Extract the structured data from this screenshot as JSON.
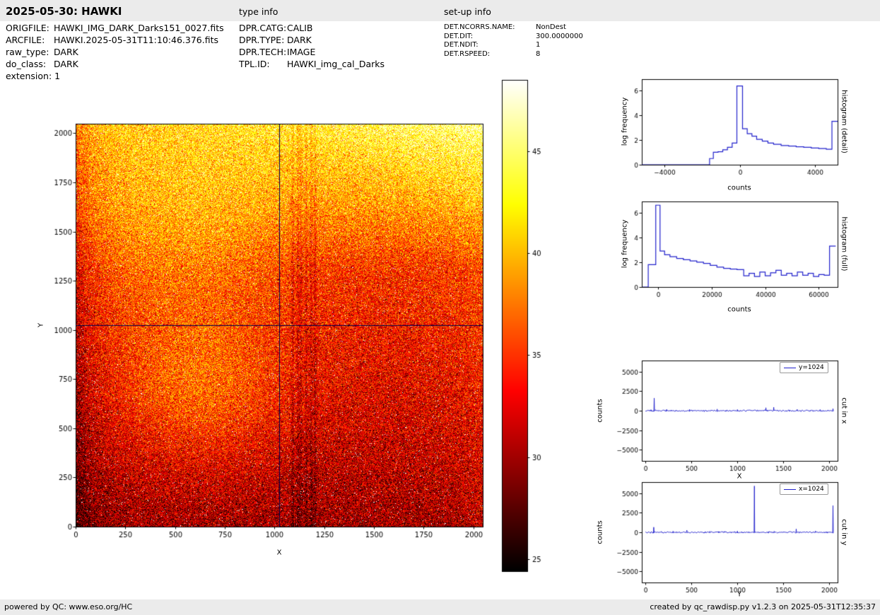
{
  "header": {
    "title": "2025-05-30: HAWKI",
    "type_info": "type info",
    "setup_info": "set-up info"
  },
  "metadata": {
    "left": [
      {
        "label": "ORIGFILE:",
        "value": "HAWKI_IMG_DARK_Darks151_0027.fits"
      },
      {
        "label": "ARCFILE:",
        "value": "HAWKI.2025-05-31T11:10:46.376.fits"
      },
      {
        "label": "raw_type:",
        "value": "DARK"
      },
      {
        "label": "do_class:",
        "value": "DARK"
      },
      {
        "label": "extension:",
        "value": "1"
      }
    ],
    "middle": [
      {
        "label": "DPR.CATG:",
        "value": "CALIB"
      },
      {
        "label": "DPR.TYPE:",
        "value": "DARK"
      },
      {
        "label": "DPR.TECH:",
        "value": "IMAGE"
      },
      {
        "label": "TPL.ID:",
        "value": "HAWKI_img_cal_Darks"
      }
    ],
    "right": [
      {
        "label": "DET.NCORRS.NAME:",
        "value": "NonDest"
      },
      {
        "label": "DET.DIT:",
        "value": "300.0000000"
      },
      {
        "label": "DET.NDIT:",
        "value": "1"
      },
      {
        "label": "DET.RSPEED:",
        "value": "8"
      }
    ]
  },
  "footer": {
    "left": "powered by QC: www.eso.org/HC",
    "right": "created by qc_rawdisp.py v1.2.3 on 2025-05-31T12:35:37"
  },
  "colors": {
    "line_blue": "#2222cc",
    "crosshair_navy": "#00004d",
    "bar_gray": "#ebebeb"
  },
  "chart_data": [
    {
      "id": "detector-image",
      "type": "heatmap",
      "xlabel": "X",
      "ylabel": "Y",
      "x_range": [
        0,
        2048
      ],
      "y_range": [
        0,
        2048
      ],
      "x_ticks": [
        0,
        250,
        500,
        750,
        1000,
        1250,
        1500,
        1750,
        2000
      ],
      "y_ticks": [
        0,
        250,
        500,
        750,
        1000,
        1250,
        1500,
        1750,
        2000
      ],
      "value_range": [
        24.4,
        48.5
      ],
      "colormap": "hot",
      "crosshair": {
        "x": 1024,
        "y": 1024,
        "color": "#00004d"
      },
      "appearance": {
        "base_level": 30.0,
        "vertical_gradient": 7.5,
        "top_boost": {
          "start_y": 1300,
          "left_amp": 3.0,
          "right_amp": 7.5
        },
        "blobs": [
          {
            "x": 620,
            "y": 680,
            "sx": 300,
            "sy": 260,
            "amp": 4.2
          },
          {
            "x": 520,
            "y": 1500,
            "sx": 380,
            "sy": 380,
            "amp": 3.0
          }
        ],
        "left_edge_dark": 3.5,
        "right_edge_boost": 1.3,
        "noise_sigma": 2.9,
        "dark_stripes_x": [
          1092,
          1118,
          1133,
          1160,
          1185,
          1205
        ]
      }
    },
    {
      "id": "colorbar",
      "type": "colorbar",
      "ticks": [
        25,
        30,
        35,
        40,
        45
      ],
      "range": [
        24.4,
        48.5
      ],
      "colormap": "hot"
    },
    {
      "id": "histogram-detail",
      "type": "bar",
      "title": "histogram (detail)",
      "xlabel": "counts",
      "ylabel": "log frequency",
      "xlim": [
        -5200,
        5200
      ],
      "ylim": [
        0,
        6.9
      ],
      "x_ticks": [
        -4000,
        0,
        4000
      ],
      "y_ticks": [
        0,
        2,
        4,
        6
      ],
      "line_color": "#2222cc",
      "bin_edges": [
        -5200,
        -1600,
        -1400,
        -1150,
        -900,
        -650,
        -400,
        -150,
        150,
        400,
        650,
        900,
        1200,
        1500,
        1800,
        2200,
        2600,
        3000,
        3400,
        3800,
        4200,
        4600,
        4900,
        5200
      ],
      "log_heights": [
        0,
        0.5,
        1.0,
        1.05,
        1.2,
        1.4,
        1.75,
        6.35,
        2.9,
        2.5,
        2.3,
        2.05,
        1.9,
        1.75,
        1.65,
        1.55,
        1.5,
        1.45,
        1.4,
        1.35,
        1.3,
        1.25,
        3.5
      ]
    },
    {
      "id": "histogram-full",
      "type": "bar",
      "title": "histogram (full)",
      "xlabel": "counts",
      "ylabel": "log frequency",
      "xlim": [
        -6000,
        67000
      ],
      "ylim": [
        0,
        6.9
      ],
      "x_ticks": [
        0,
        20000,
        40000,
        60000
      ],
      "y_ticks": [
        0,
        2,
        4,
        6
      ],
      "line_color": "#2222cc",
      "bin_edges": [
        -5700,
        -3600,
        -800,
        800,
        2500,
        4500,
        7000,
        9500,
        12000,
        14500,
        17000,
        19500,
        22000,
        24500,
        27000,
        29500,
        32000,
        34000,
        36000,
        38000,
        40000,
        42000,
        44000,
        46000,
        48000,
        50000,
        52000,
        54000,
        56000,
        58000,
        60000,
        62000,
        64000,
        66300
      ],
      "log_heights": [
        0,
        1.8,
        6.6,
        2.9,
        2.6,
        2.45,
        2.3,
        2.2,
        2.1,
        2.0,
        1.9,
        1.75,
        1.6,
        1.5,
        1.45,
        1.4,
        0.9,
        1.1,
        0.85,
        1.2,
        0.9,
        1.15,
        1.35,
        0.95,
        1.1,
        0.9,
        1.2,
        0.95,
        1.1,
        0.85,
        1.0,
        0.95,
        3.3
      ]
    },
    {
      "id": "cut-in-x",
      "type": "line",
      "title": "cut in x",
      "xlabel": "X",
      "ylabel": "counts",
      "legend": "y=1024",
      "xlim": [
        -40,
        2090
      ],
      "ylim": [
        -6400,
        6400
      ],
      "x_ticks": [
        0,
        500,
        1000,
        1500,
        2000
      ],
      "y_ticks": [
        -5000,
        -2500,
        0,
        2500,
        5000
      ],
      "line_color": "#2222cc",
      "baseline": 0,
      "noise_amp": 120,
      "spikes": [
        [
          60,
          120
        ],
        [
          95,
          1600
        ],
        [
          230,
          160
        ],
        [
          480,
          170
        ],
        [
          640,
          -120
        ],
        [
          780,
          200
        ],
        [
          1000,
          140
        ],
        [
          1310,
          380
        ],
        [
          1395,
          450
        ],
        [
          1650,
          150
        ],
        [
          1900,
          130
        ],
        [
          2040,
          260
        ]
      ]
    },
    {
      "id": "cut-in-y",
      "type": "line",
      "title": "cut in y",
      "xlabel": "Y",
      "ylabel": "counts",
      "legend": "x=1024",
      "xlim": [
        -40,
        2090
      ],
      "ylim": [
        -6400,
        6400
      ],
      "x_ticks": [
        0,
        500,
        1000,
        1500,
        2000
      ],
      "y_ticks": [
        -5000,
        -2500,
        0,
        2500,
        5000
      ],
      "line_color": "#2222cc",
      "baseline": 0,
      "noise_amp": 120,
      "spikes": [
        [
          90,
          650
        ],
        [
          300,
          140
        ],
        [
          450,
          260
        ],
        [
          700,
          120
        ],
        [
          1000,
          150
        ],
        [
          1185,
          5900
        ],
        [
          1400,
          130
        ],
        [
          1640,
          420
        ],
        [
          1850,
          160
        ],
        [
          2040,
          3400
        ]
      ]
    }
  ]
}
